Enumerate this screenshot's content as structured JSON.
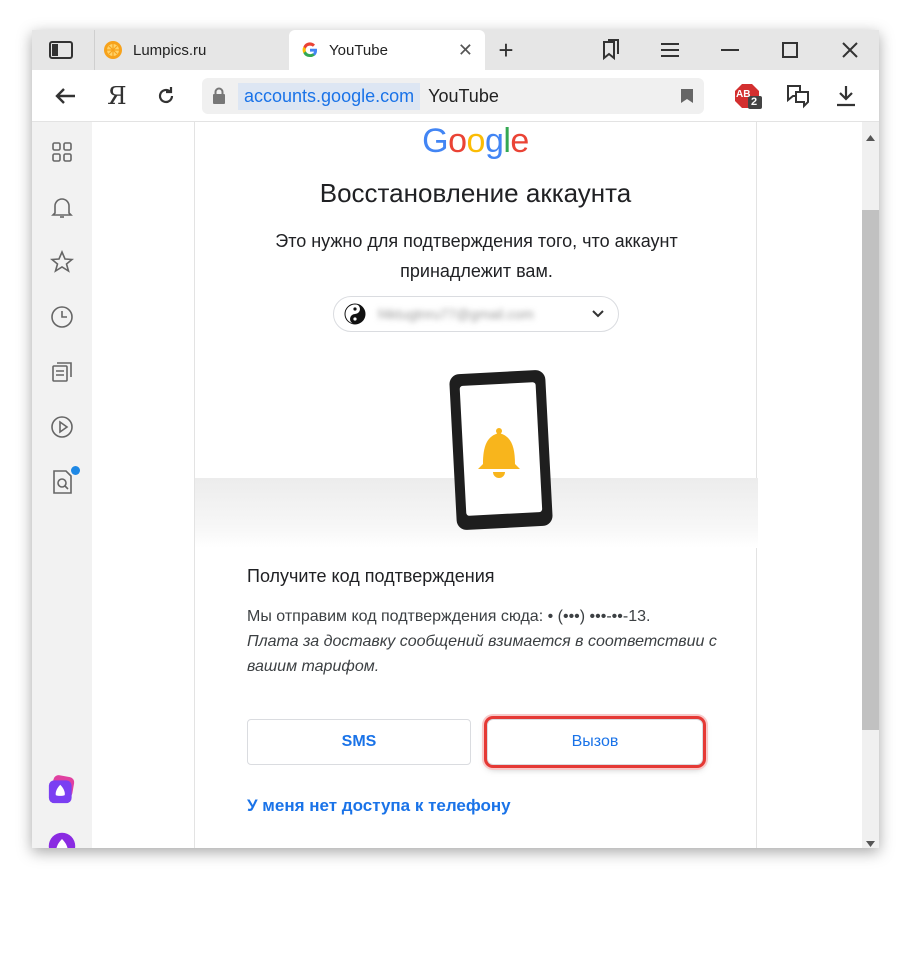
{
  "browser": {
    "tabs": [
      {
        "label": "Lumpics.ru",
        "icon": "orange-slice-icon"
      },
      {
        "label": "YouTube",
        "icon": "google-g-icon"
      }
    ],
    "yandex_button": "Я",
    "address": {
      "domain": "accounts.google.com",
      "title": "YouTube"
    },
    "adblock_badge": "2",
    "adblock_label": "AB"
  },
  "page": {
    "logo": "Google",
    "heading": "Восстановление аккаунта",
    "subtext": "Это нужно для подтверждения того, что аккаунт принадлежит вам.",
    "account_email": "f4ktugtnru77@gmail.com",
    "section_title": "Получите код подтверждения",
    "info_line": "Мы отправим код подтверждения сюда: • (•••) •••-••-13.",
    "info_italic": "Плата за доставку сообщений взимается в соответствии с вашим тарифом.",
    "sms_button": "SMS",
    "call_button": "Вызов",
    "no_access_link": "У меня нет доступа к телефону"
  },
  "colors": {
    "accent": "#1a73e8",
    "highlight": "#e53935"
  }
}
